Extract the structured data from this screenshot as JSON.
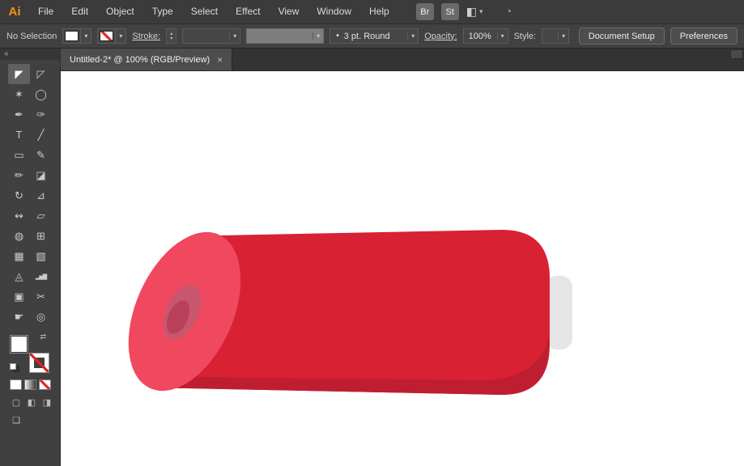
{
  "app": {
    "logo_text": "Ai"
  },
  "menubar": {
    "items": [
      "File",
      "Edit",
      "Object",
      "Type",
      "Select",
      "Effect",
      "View",
      "Window",
      "Help"
    ],
    "bridge_label": "Br",
    "stock_label": "St"
  },
  "controlbar": {
    "selection_status": "No Selection",
    "stroke_label": "Stroke:",
    "stroke_weight_value": "",
    "brush_value": "",
    "brush_bullet": "•",
    "brush_definition": "3 pt. Round",
    "opacity_label": "Opacity:",
    "opacity_value": "100%",
    "style_label": "Style:",
    "document_setup_label": "Document Setup",
    "preferences_label": "Preferences"
  },
  "tabbar": {
    "tab_title": "Untitled-2* @ 100% (RGB/Preview)",
    "close_glyph": "×"
  },
  "toolbar": {
    "collapse_glyph": "«",
    "tools": [
      {
        "name": "selection-tool",
        "glyph": "◤"
      },
      {
        "name": "direct-selection-tool",
        "glyph": "◸"
      },
      {
        "name": "magic-wand-tool",
        "glyph": "✶"
      },
      {
        "name": "lasso-tool",
        "glyph": "◯"
      },
      {
        "name": "pen-tool",
        "glyph": "✒"
      },
      {
        "name": "curvature-tool",
        "glyph": "✑"
      },
      {
        "name": "type-tool",
        "glyph": "T"
      },
      {
        "name": "line-segment-tool",
        "glyph": "╱"
      },
      {
        "name": "rectangle-tool",
        "glyph": "▭"
      },
      {
        "name": "paintbrush-tool",
        "glyph": "✎"
      },
      {
        "name": "pencil-tool",
        "glyph": "✏"
      },
      {
        "name": "eraser-tool",
        "glyph": "◪"
      },
      {
        "name": "rotate-tool",
        "glyph": "↻"
      },
      {
        "name": "scale-tool",
        "glyph": "⊿"
      },
      {
        "name": "width-tool",
        "glyph": "↭"
      },
      {
        "name": "free-transform-tool",
        "glyph": "▱"
      },
      {
        "name": "shape-builder-tool",
        "glyph": "◍"
      },
      {
        "name": "perspective-grid-tool",
        "glyph": "⊞"
      },
      {
        "name": "mesh-tool",
        "glyph": "▦"
      },
      {
        "name": "gradient-tool",
        "glyph": "▧"
      },
      {
        "name": "eyedropper-tool",
        "glyph": "◬"
      },
      {
        "name": "graph-tool",
        "glyph": "▂▅▇"
      },
      {
        "name": "artboard-tool",
        "glyph": "▣"
      },
      {
        "name": "slice-tool",
        "glyph": "✂"
      },
      {
        "name": "hand-tool",
        "glyph": "☛"
      },
      {
        "name": "zoom-tool",
        "glyph": "◎"
      }
    ],
    "modes": [
      {
        "name": "draw-normal-mode",
        "glyph": "▢"
      },
      {
        "name": "draw-behind-mode",
        "glyph": "◧"
      },
      {
        "name": "draw-inside-mode",
        "glyph": "◨"
      }
    ],
    "screen_mode_glyph": "❏"
  },
  "ui": {
    "caret": "▾",
    "stepper_up": "▴",
    "stepper_down": "▾",
    "swap": "⇄",
    "layout_icon": "◧",
    "gpu_icon": "◔"
  },
  "artwork": {
    "body_color": "#d92134",
    "shade_color": "#bf1e30",
    "face_color": "#f0485e",
    "hole_outer_color": "#c9566f",
    "hole_inner_color": "#b84159",
    "cap_color": "#e5e5e8"
  }
}
